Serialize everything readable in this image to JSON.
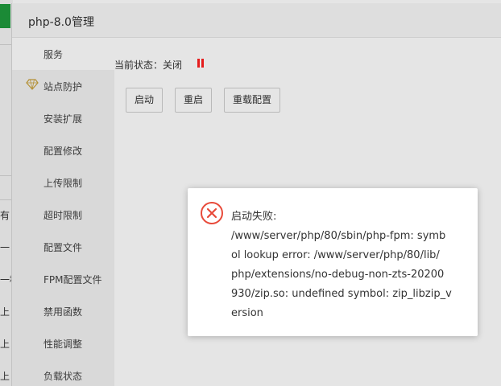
{
  "background": {
    "fragments": [
      "有",
      "一",
      "一种",
      "上",
      "上",
      "上"
    ]
  },
  "window": {
    "title": "php-8.0管理"
  },
  "menu": {
    "items": [
      {
        "label": "服务",
        "icon": ""
      },
      {
        "label": "站点防护",
        "icon": "gem-icon"
      },
      {
        "label": "安装扩展",
        "icon": ""
      },
      {
        "label": "配置修改",
        "icon": ""
      },
      {
        "label": "上传限制",
        "icon": ""
      },
      {
        "label": "超时限制",
        "icon": ""
      },
      {
        "label": "配置文件",
        "icon": ""
      },
      {
        "label": "FPM配置文件",
        "icon": ""
      },
      {
        "label": "禁用函数",
        "icon": ""
      },
      {
        "label": "性能调整",
        "icon": ""
      },
      {
        "label": "负载状态",
        "icon": ""
      }
    ]
  },
  "service": {
    "status_label": "当前状态：关闭",
    "status_icon": "pause-icon",
    "status_color": "#ff2020",
    "buttons": {
      "start": "启动",
      "restart": "重启",
      "reload": "重载配置"
    }
  },
  "dialog": {
    "icon": "error-circle-icon",
    "icon_color": "#e84a3a",
    "lines": [
      "启动失败:",
      "/www/server/php/80/sbin/php-fpm: symb",
      "ol lookup error: /www/server/php/80/lib/",
      "php/extensions/no-debug-non-zts-20200",
      "930/zip.so: undefined symbol: zip_libzip_v",
      "ersion"
    ]
  }
}
